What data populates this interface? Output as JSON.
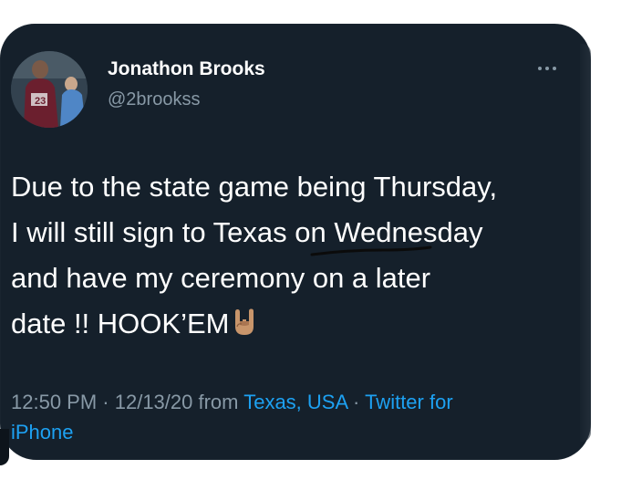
{
  "tweet": {
    "author_name": "Jonathon Brooks",
    "author_handle": "@2brookss",
    "text_lines": [
      "Due to the state game being Thursday,",
      "I will still sign to Texas on Wednesday",
      "and have my ceremony on a later",
      "date !! HOOK’EM"
    ],
    "emoji": "hook-em-horns-hand",
    "time": "12:50 PM",
    "separator": " · ",
    "date": "12/13/20",
    "from_label": " from ",
    "location": "Texas, USA",
    "source_line1": "Twitter for",
    "source_line2": "iPhone"
  },
  "icons": {
    "more": "more-options-icon",
    "avatar": "profile-avatar"
  },
  "colors": {
    "background": "#15202b",
    "text": "#ffffff",
    "secondary": "#8899a6",
    "link": "#1da1f2"
  }
}
